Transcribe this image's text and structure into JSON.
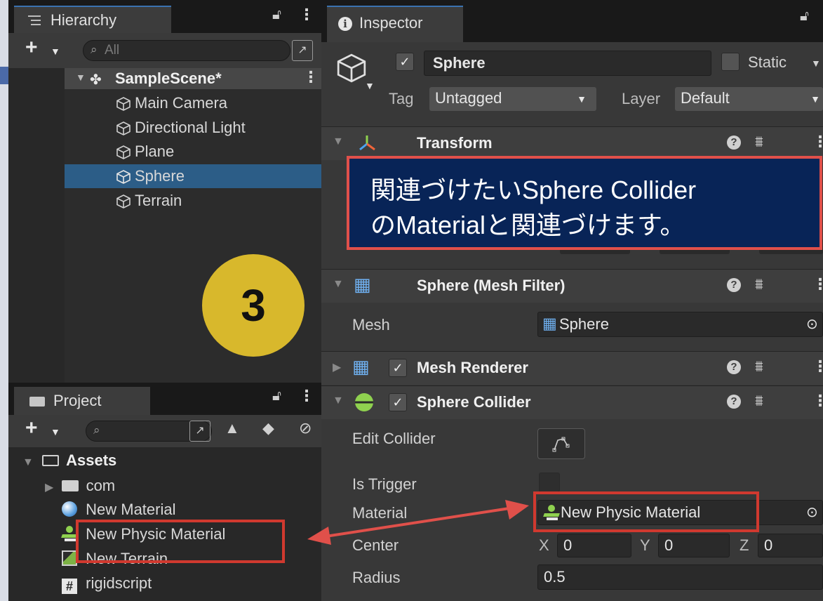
{
  "hierarchy": {
    "tab_label": "Hierarchy",
    "search_placeholder": "All",
    "scene_name": "SampleScene*",
    "objects": [
      "Main Camera",
      "Directional Light",
      "Plane",
      "Sphere",
      "Terrain"
    ],
    "selected_object": "Sphere"
  },
  "step_badge": "3",
  "project": {
    "tab_label": "Project",
    "root_folder": "Assets",
    "items": [
      {
        "label": "com",
        "icon": "folder-icon"
      },
      {
        "label": "New Material",
        "icon": "material-icon"
      },
      {
        "label": "New Physic Material",
        "icon": "physic-material-icon"
      },
      {
        "label": "New Terrain",
        "icon": "terrain-icon"
      },
      {
        "label": "rigidscript",
        "icon": "script-icon"
      }
    ]
  },
  "inspector": {
    "tab_label": "Inspector",
    "object_name": "Sphere",
    "static_label": "Static",
    "tag_label": "Tag",
    "tag_value": "Untagged",
    "layer_label": "Layer",
    "layer_value": "Default",
    "components": {
      "transform": "Transform",
      "mesh_filter": "Sphere (Mesh Filter)",
      "mesh_renderer": "Mesh Renderer",
      "sphere_collider": "Sphere Collider"
    },
    "mesh_filter": {
      "mesh_label": "Mesh",
      "mesh_value": "Sphere"
    },
    "sphere_collider": {
      "edit_collider_label": "Edit Collider",
      "is_trigger_label": "Is Trigger",
      "material_label": "Material",
      "material_value": "New Physic Material",
      "center_label": "Center",
      "center": {
        "x_label": "X",
        "x": "0",
        "y_label": "Y",
        "y": "0",
        "z_label": "Z",
        "z": "0"
      },
      "radius_label": "Radius",
      "radius": "0.5"
    }
  },
  "callout": {
    "line1": "関連づけたいSphere Collider",
    "line2": "のMaterialと関連づけます。"
  },
  "colors": {
    "accent_blue": "#2c5d87",
    "badge_yellow": "#d8b82c",
    "callout_bg": "#082457",
    "annotation_red": "#d0392f"
  }
}
